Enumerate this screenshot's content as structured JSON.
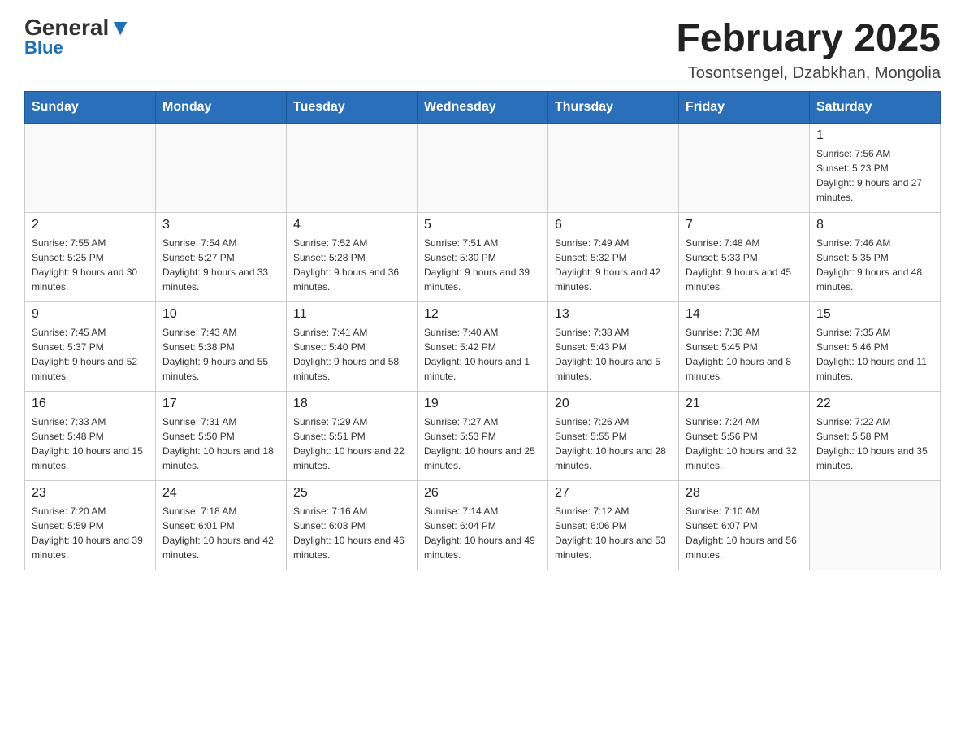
{
  "header": {
    "logo_text": "General",
    "logo_blue": "Blue",
    "month_title": "February 2025",
    "location": "Tosontsengel, Dzabkhan, Mongolia"
  },
  "weekdays": [
    "Sunday",
    "Monday",
    "Tuesday",
    "Wednesday",
    "Thursday",
    "Friday",
    "Saturday"
  ],
  "weeks": [
    [
      {
        "day": "",
        "info": ""
      },
      {
        "day": "",
        "info": ""
      },
      {
        "day": "",
        "info": ""
      },
      {
        "day": "",
        "info": ""
      },
      {
        "day": "",
        "info": ""
      },
      {
        "day": "",
        "info": ""
      },
      {
        "day": "1",
        "info": "Sunrise: 7:56 AM\nSunset: 5:23 PM\nDaylight: 9 hours and 27 minutes."
      }
    ],
    [
      {
        "day": "2",
        "info": "Sunrise: 7:55 AM\nSunset: 5:25 PM\nDaylight: 9 hours and 30 minutes."
      },
      {
        "day": "3",
        "info": "Sunrise: 7:54 AM\nSunset: 5:27 PM\nDaylight: 9 hours and 33 minutes."
      },
      {
        "day": "4",
        "info": "Sunrise: 7:52 AM\nSunset: 5:28 PM\nDaylight: 9 hours and 36 minutes."
      },
      {
        "day": "5",
        "info": "Sunrise: 7:51 AM\nSunset: 5:30 PM\nDaylight: 9 hours and 39 minutes."
      },
      {
        "day": "6",
        "info": "Sunrise: 7:49 AM\nSunset: 5:32 PM\nDaylight: 9 hours and 42 minutes."
      },
      {
        "day": "7",
        "info": "Sunrise: 7:48 AM\nSunset: 5:33 PM\nDaylight: 9 hours and 45 minutes."
      },
      {
        "day": "8",
        "info": "Sunrise: 7:46 AM\nSunset: 5:35 PM\nDaylight: 9 hours and 48 minutes."
      }
    ],
    [
      {
        "day": "9",
        "info": "Sunrise: 7:45 AM\nSunset: 5:37 PM\nDaylight: 9 hours and 52 minutes."
      },
      {
        "day": "10",
        "info": "Sunrise: 7:43 AM\nSunset: 5:38 PM\nDaylight: 9 hours and 55 minutes."
      },
      {
        "day": "11",
        "info": "Sunrise: 7:41 AM\nSunset: 5:40 PM\nDaylight: 9 hours and 58 minutes."
      },
      {
        "day": "12",
        "info": "Sunrise: 7:40 AM\nSunset: 5:42 PM\nDaylight: 10 hours and 1 minute."
      },
      {
        "day": "13",
        "info": "Sunrise: 7:38 AM\nSunset: 5:43 PM\nDaylight: 10 hours and 5 minutes."
      },
      {
        "day": "14",
        "info": "Sunrise: 7:36 AM\nSunset: 5:45 PM\nDaylight: 10 hours and 8 minutes."
      },
      {
        "day": "15",
        "info": "Sunrise: 7:35 AM\nSunset: 5:46 PM\nDaylight: 10 hours and 11 minutes."
      }
    ],
    [
      {
        "day": "16",
        "info": "Sunrise: 7:33 AM\nSunset: 5:48 PM\nDaylight: 10 hours and 15 minutes."
      },
      {
        "day": "17",
        "info": "Sunrise: 7:31 AM\nSunset: 5:50 PM\nDaylight: 10 hours and 18 minutes."
      },
      {
        "day": "18",
        "info": "Sunrise: 7:29 AM\nSunset: 5:51 PM\nDaylight: 10 hours and 22 minutes."
      },
      {
        "day": "19",
        "info": "Sunrise: 7:27 AM\nSunset: 5:53 PM\nDaylight: 10 hours and 25 minutes."
      },
      {
        "day": "20",
        "info": "Sunrise: 7:26 AM\nSunset: 5:55 PM\nDaylight: 10 hours and 28 minutes."
      },
      {
        "day": "21",
        "info": "Sunrise: 7:24 AM\nSunset: 5:56 PM\nDaylight: 10 hours and 32 minutes."
      },
      {
        "day": "22",
        "info": "Sunrise: 7:22 AM\nSunset: 5:58 PM\nDaylight: 10 hours and 35 minutes."
      }
    ],
    [
      {
        "day": "23",
        "info": "Sunrise: 7:20 AM\nSunset: 5:59 PM\nDaylight: 10 hours and 39 minutes."
      },
      {
        "day": "24",
        "info": "Sunrise: 7:18 AM\nSunset: 6:01 PM\nDaylight: 10 hours and 42 minutes."
      },
      {
        "day": "25",
        "info": "Sunrise: 7:16 AM\nSunset: 6:03 PM\nDaylight: 10 hours and 46 minutes."
      },
      {
        "day": "26",
        "info": "Sunrise: 7:14 AM\nSunset: 6:04 PM\nDaylight: 10 hours and 49 minutes."
      },
      {
        "day": "27",
        "info": "Sunrise: 7:12 AM\nSunset: 6:06 PM\nDaylight: 10 hours and 53 minutes."
      },
      {
        "day": "28",
        "info": "Sunrise: 7:10 AM\nSunset: 6:07 PM\nDaylight: 10 hours and 56 minutes."
      },
      {
        "day": "",
        "info": ""
      }
    ]
  ]
}
